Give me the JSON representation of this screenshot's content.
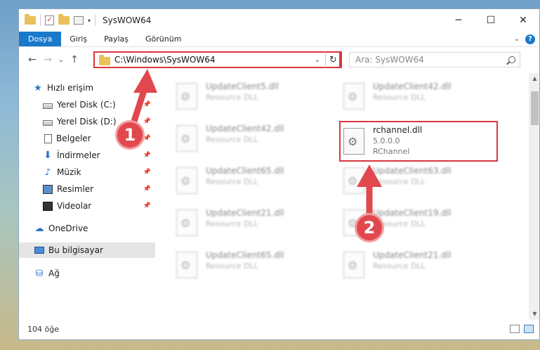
{
  "window": {
    "title": "SysWOW64",
    "controls": [
      "─",
      "☐",
      "✕"
    ]
  },
  "qat": {
    "check": "✓",
    "arrow": "▾"
  },
  "ribbon": {
    "tabs": [
      "Dosya",
      "Giriş",
      "Paylaş",
      "Görünüm"
    ],
    "collapse": "⌄",
    "help": "?"
  },
  "nav": {
    "back": "←",
    "forward": "→",
    "recent": "⌄",
    "up": "↑"
  },
  "address": {
    "path": "C:\\Windows\\SysWOW64",
    "dropdown": "⌄",
    "refresh": "↻"
  },
  "search": {
    "placeholder": "Ara: SysWOW64"
  },
  "sidebar": {
    "items": [
      {
        "label": "Hızlı erişim",
        "icon": "star-icon",
        "glyph": "★"
      },
      {
        "label": "Yerel Disk (C:)",
        "icon": "disk-icon",
        "pinned": true
      },
      {
        "label": "Yerel Disk (D:)",
        "icon": "disk-icon",
        "pinned": true
      },
      {
        "label": "Belgeler",
        "icon": "document-icon",
        "pinned": true
      },
      {
        "label": "İndirmeler",
        "icon": "download-icon",
        "glyph": "⬇",
        "pinned": true
      },
      {
        "label": "Müzik",
        "icon": "music-icon",
        "glyph": "♪",
        "pinned": true
      },
      {
        "label": "Resimler",
        "icon": "pictures-icon",
        "pinned": true
      },
      {
        "label": "Videolar",
        "icon": "video-icon",
        "pinned": true
      },
      {
        "label": "OneDrive",
        "icon": "cloud-icon",
        "glyph": "☁"
      },
      {
        "label": "Bu bilgisayar",
        "icon": "computer-icon",
        "selected": true
      },
      {
        "label": "Ağ",
        "icon": "network-icon",
        "glyph": "⛁"
      }
    ],
    "pin_glyph": "📌"
  },
  "files": [
    {
      "name": "UpdateClient5.dll",
      "type": "Resource DLL"
    },
    {
      "name": "UpdateClient42.dll",
      "type": "Resource DLL"
    },
    {
      "name": "UpdateClient42.dll",
      "type": "Resource DLL"
    },
    {
      "name": "rchannel.dll",
      "version": "5.0.0.0",
      "desc": "RChannel",
      "highlighted": true
    },
    {
      "name": "UpdateClient65.dll",
      "type": "Resource DLL"
    },
    {
      "name": "UpdateClient63.dll",
      "type": "Resource DLL"
    },
    {
      "name": "UpdateClient21.dll",
      "type": "Resource DLL"
    },
    {
      "name": "UpdateClient19.dll",
      "type": "Resource DLL"
    },
    {
      "name": "UpdateClient65.dll",
      "type": "Resource DLL"
    },
    {
      "name": "UpdateClient21.dll",
      "type": "Resource DLL"
    }
  ],
  "scroll": {
    "up": "▲",
    "down": "▼"
  },
  "status": {
    "count": "104 öğe"
  },
  "annotations": {
    "badge1": "1",
    "badge2": "2",
    "color": "#e0484d"
  }
}
